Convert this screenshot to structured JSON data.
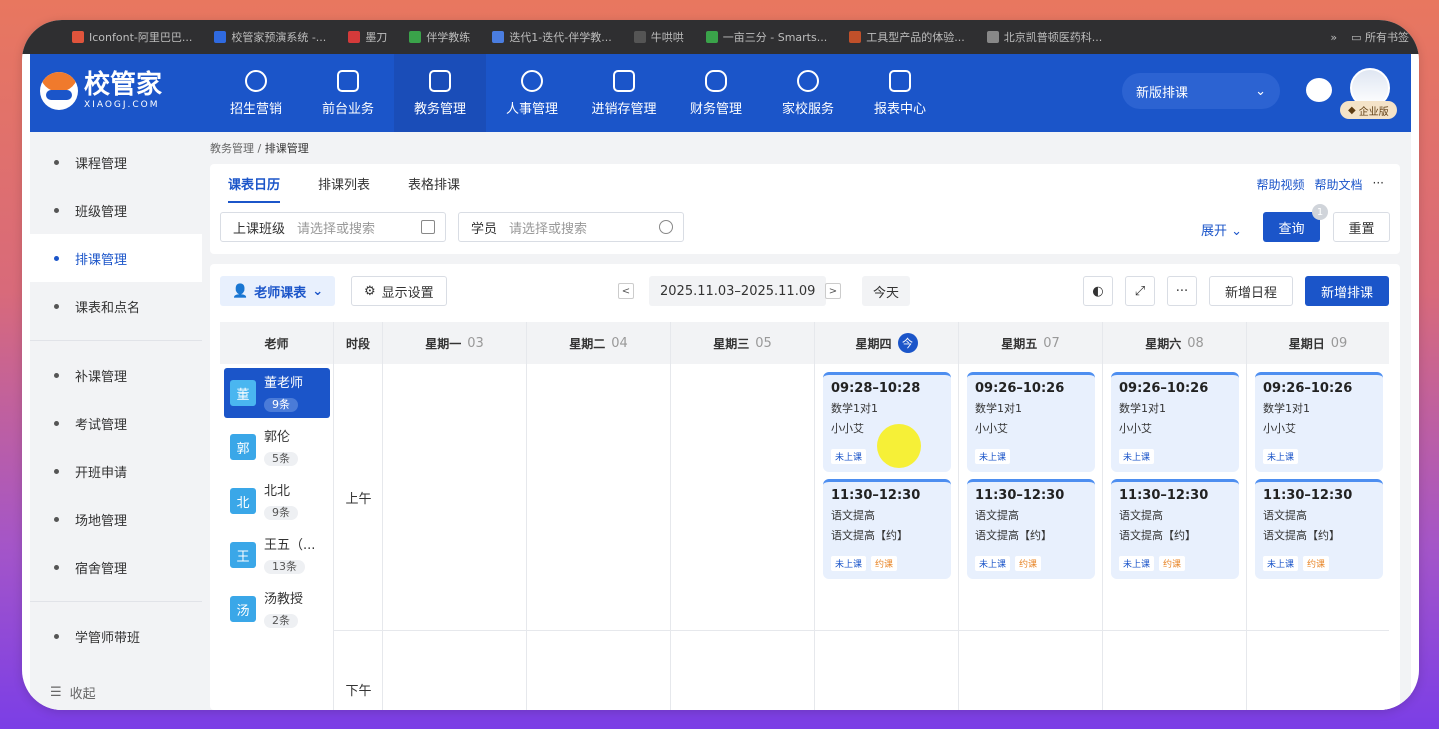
{
  "bookmarks": [
    {
      "label": "Iconfont-阿里巴巴...",
      "color": "#e0543c"
    },
    {
      "label": "校管家预演系统 -...",
      "color": "#2f6ae0"
    },
    {
      "label": "墨刀",
      "color": "#d43a3a"
    },
    {
      "label": "伴学教练",
      "color": "#3aa34a"
    },
    {
      "label": "迭代1-迭代-伴学教...",
      "color": "#4a7de0"
    },
    {
      "label": "牛哄哄",
      "color": "#555555"
    },
    {
      "label": "一亩三分 - Smarts...",
      "color": "#3aa34a"
    },
    {
      "label": "工具型产品的体验...",
      "color": "#c0502a"
    },
    {
      "label": "北京凯普顿医药科...",
      "color": "#888888"
    }
  ],
  "bookmarks_right": {
    "overflow": "»",
    "all_label": "所有书签"
  },
  "logo": {
    "name": "校管家",
    "sub": "XIAOGJ.COM"
  },
  "nav": [
    {
      "label": "招生营销",
      "icon": "user-plus-icon"
    },
    {
      "label": "前台业务",
      "icon": "reception-icon"
    },
    {
      "label": "教务管理",
      "icon": "book-icon",
      "active": true
    },
    {
      "label": "人事管理",
      "icon": "person-icon"
    },
    {
      "label": "进销存管理",
      "icon": "inventory-icon"
    },
    {
      "label": "财务管理",
      "icon": "finance-icon"
    },
    {
      "label": "家校服务",
      "icon": "service-icon"
    },
    {
      "label": "报表中心",
      "icon": "report-icon"
    }
  ],
  "header_select": "新版排课",
  "enterprise_badge": "企业版",
  "sidebar": {
    "items": [
      "课程管理",
      "班级管理",
      "排课管理",
      "课表和点名",
      "补课管理",
      "考试管理",
      "开班申请",
      "场地管理",
      "宿舍管理",
      "学管师带班"
    ],
    "active_index": 2,
    "collapse": "收起"
  },
  "breadcrumb": {
    "parent": "教务管理",
    "sep": "/",
    "current": "排课管理"
  },
  "tabs": [
    "课表日历",
    "排课列表",
    "表格排课"
  ],
  "help": {
    "video": "帮助视频",
    "doc": "帮助文档",
    "more": "···"
  },
  "filters": {
    "class": {
      "label": "上课班级",
      "placeholder": "请选择或搜索"
    },
    "student": {
      "label": "学员",
      "placeholder": "请选择或搜索"
    },
    "expand": "展开",
    "query": "查询",
    "query_badge": "1",
    "reset": "重置"
  },
  "toolbar": {
    "view": "老师课表",
    "display": "显示设置",
    "prev": "<",
    "date_range": "2025.11.03–2025.11.09",
    "next": ">",
    "today": "今天",
    "more": "···",
    "new_schedule": "新增日程",
    "new_course": "新增排课"
  },
  "grid": {
    "teacher_header": "老师",
    "period_header": "时段",
    "days": [
      {
        "name": "星期一",
        "num": "03"
      },
      {
        "name": "星期二",
        "num": "04"
      },
      {
        "name": "星期三",
        "num": "05"
      },
      {
        "name": "星期四",
        "num": "",
        "today": "今"
      },
      {
        "name": "星期五",
        "num": "07"
      },
      {
        "name": "星期六",
        "num": "08"
      },
      {
        "name": "星期日",
        "num": "09"
      }
    ],
    "periods": [
      "上午",
      "下午"
    ]
  },
  "teachers": [
    {
      "avatar": "董",
      "name": "董老师",
      "count": "9条"
    },
    {
      "avatar": "郭",
      "name": "郭伦",
      "count": "5条"
    },
    {
      "avatar": "北",
      "name": "北北",
      "count": "9条"
    },
    {
      "avatar": "王",
      "name": "王五（...",
      "count": "13条"
    },
    {
      "avatar": "汤",
      "name": "汤教授",
      "count": "2条"
    }
  ],
  "events": {
    "morning1": [
      {
        "time": "09:28–10:28",
        "course": "数学1对1",
        "student": "小小艾",
        "status": "未上课"
      },
      {
        "time": "09:26–10:26",
        "course": "数学1对1",
        "student": "小小艾",
        "status": "未上课"
      },
      {
        "time": "09:26–10:26",
        "course": "数学1对1",
        "student": "小小艾",
        "status": "未上课"
      },
      {
        "time": "09:26–10:26",
        "course": "数学1对1",
        "student": "小小艾",
        "status": "未上课"
      }
    ],
    "morning2": [
      {
        "time": "11:30–12:30",
        "course": "语文提高",
        "student": "语文提高【约】",
        "status": "未上课",
        "tag2": "约课"
      },
      {
        "time": "11:30–12:30",
        "course": "语文提高",
        "student": "语文提高【约】",
        "status": "未上课",
        "tag2": "约课"
      },
      {
        "time": "11:30–12:30",
        "course": "语文提高",
        "student": "语文提高【约】",
        "status": "未上课",
        "tag2": "约课"
      },
      {
        "time": "11:30–12:30",
        "course": "语文提高",
        "student": "语文提高【约】",
        "status": "未上课",
        "tag2": "约课"
      }
    ]
  }
}
